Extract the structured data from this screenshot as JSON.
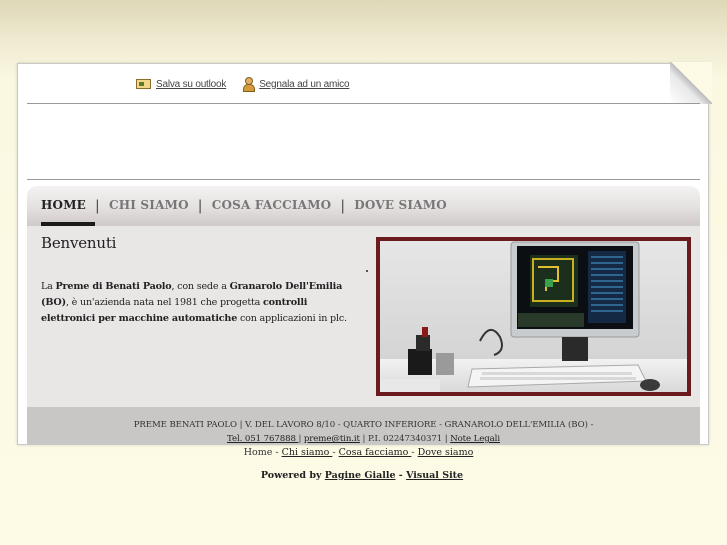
{
  "toplinks": {
    "outlook_label": "Salva su outlook",
    "friend_label": "Segnala ad un amico"
  },
  "nav": {
    "items": [
      "HOME",
      "CHI SIAMO",
      "COSA FACCIAMO",
      "DOVE SIAMO"
    ],
    "separator": "|",
    "active": "HOME"
  },
  "main": {
    "title": "Benvenuti",
    "p1": "La ",
    "p2": "Preme di Benati Paolo",
    "p3": ", con sede a ",
    "p4": "Granarolo Dell'Emilia (BO)",
    "p5": ", è un'azienda nata nel 1981 che progetta ",
    "p6": "controlli elettronici per macchine automatiche",
    "p7": " con applicazioni in plc."
  },
  "footer": {
    "line1": "PREME BENATI PAOLO | V. DEL LAVORO 8/10 - QUARTO INFERIORE - GRANAROLO DELL'EMILIA (BO) -",
    "tel": "Tel. 051 767888 ",
    "sep": "|",
    "email": "preme@tin.it",
    "piva": " | P.I. 02247340371 | ",
    "legal": "Note Legali"
  },
  "bottomnav": {
    "home": "Home",
    "dash": " - ",
    "chi": "Chi siamo ",
    "cosa": "Cosa facciamo ",
    "dove": "Dove siamo"
  },
  "powered": {
    "label": "Powered by ",
    "pg": "Pagine Gialle",
    "dash": " - ",
    "vs": "Visual Site"
  },
  "colors": {
    "photo_frame": "#6b1a1e",
    "content_bg": "#e9e6e6",
    "footer_bg": "#c9c6c6",
    "page_bg": "#fdfbe6"
  },
  "icons": [
    "outlook-icon",
    "friend-icon"
  ]
}
